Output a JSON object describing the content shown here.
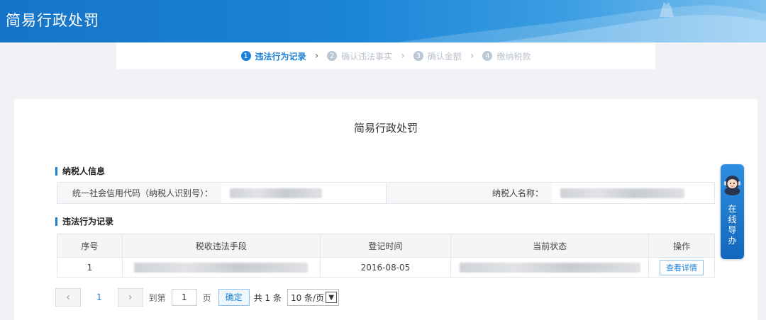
{
  "header": {
    "title": "简易行政处罚"
  },
  "steps": [
    {
      "num": "1",
      "label": "违法行为记录"
    },
    {
      "num": "2",
      "label": "确认违法事实"
    },
    {
      "num": "3",
      "label": "确认金额"
    },
    {
      "num": "4",
      "label": "缴纳税款"
    }
  ],
  "main": {
    "title": "简易行政处罚",
    "taxpayer": {
      "section_title": "纳税人信息",
      "code_label": "统一社会信用代码（纳税人识别号）：",
      "name_label": "纳税人名称："
    },
    "records": {
      "section_title": "违法行为记录",
      "columns": [
        "序号",
        "税收违法手段",
        "登记时间",
        "当前状态",
        "操作"
      ],
      "rows": [
        {
          "index": "1",
          "date": "2016-08-05",
          "action": "查看详情"
        }
      ]
    }
  },
  "pager": {
    "prev": "‹",
    "current_page": "1",
    "next": "›",
    "goto_label": "到第",
    "goto_value": "1",
    "page_unit": "页",
    "confirm": "确定",
    "total": "共 1 条",
    "page_size": "10 条/页"
  },
  "guide": {
    "label": "在线导办"
  }
}
